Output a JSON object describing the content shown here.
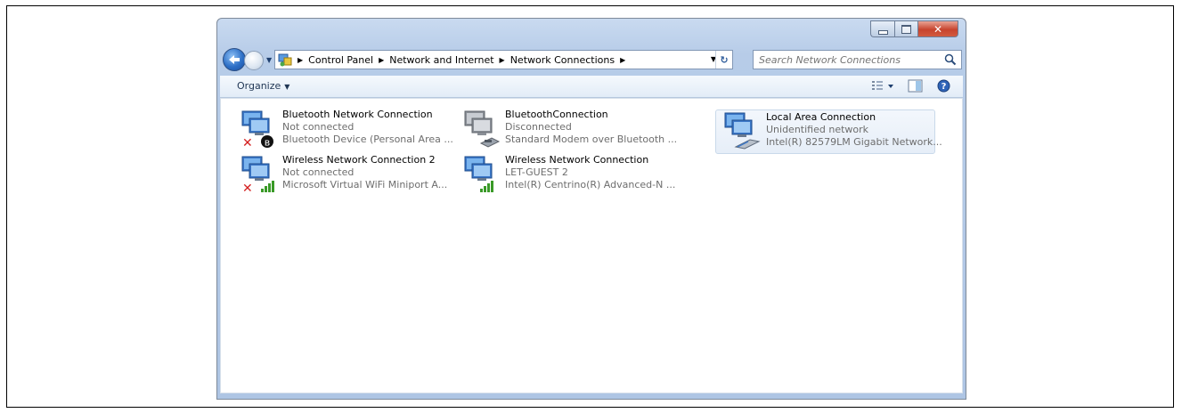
{
  "address_bar": {
    "crumbs": [
      "Control Panel",
      "Network and Internet",
      "Network Connections"
    ]
  },
  "search": {
    "placeholder": "Search Network Connections"
  },
  "toolbar": {
    "organize_label": "Organize"
  },
  "connections": [
    {
      "name": "Bluetooth Network Connection",
      "status": "Not connected",
      "device": "Bluetooth Device (Personal Area ..."
    },
    {
      "name": "BluetoothConnection",
      "status": "Disconnected",
      "device": "Standard Modem over Bluetooth ..."
    },
    {
      "name": "Local Area Connection",
      "status": "Unidentified network",
      "device": "Intel(R) 82579LM Gigabit Network..."
    },
    {
      "name": "Wireless Network Connection 2",
      "status": "Not connected",
      "device": "Microsoft Virtual WiFi Miniport A..."
    },
    {
      "name": "Wireless Network Connection",
      "status": "LET-GUEST 2",
      "device": "Intel(R) Centrino(R) Advanced-N ..."
    }
  ],
  "colors": {
    "close_button": "#c7442e",
    "signal_green": "#3a9a28",
    "error_red": "#d42020",
    "selection": "#e6eef8"
  }
}
